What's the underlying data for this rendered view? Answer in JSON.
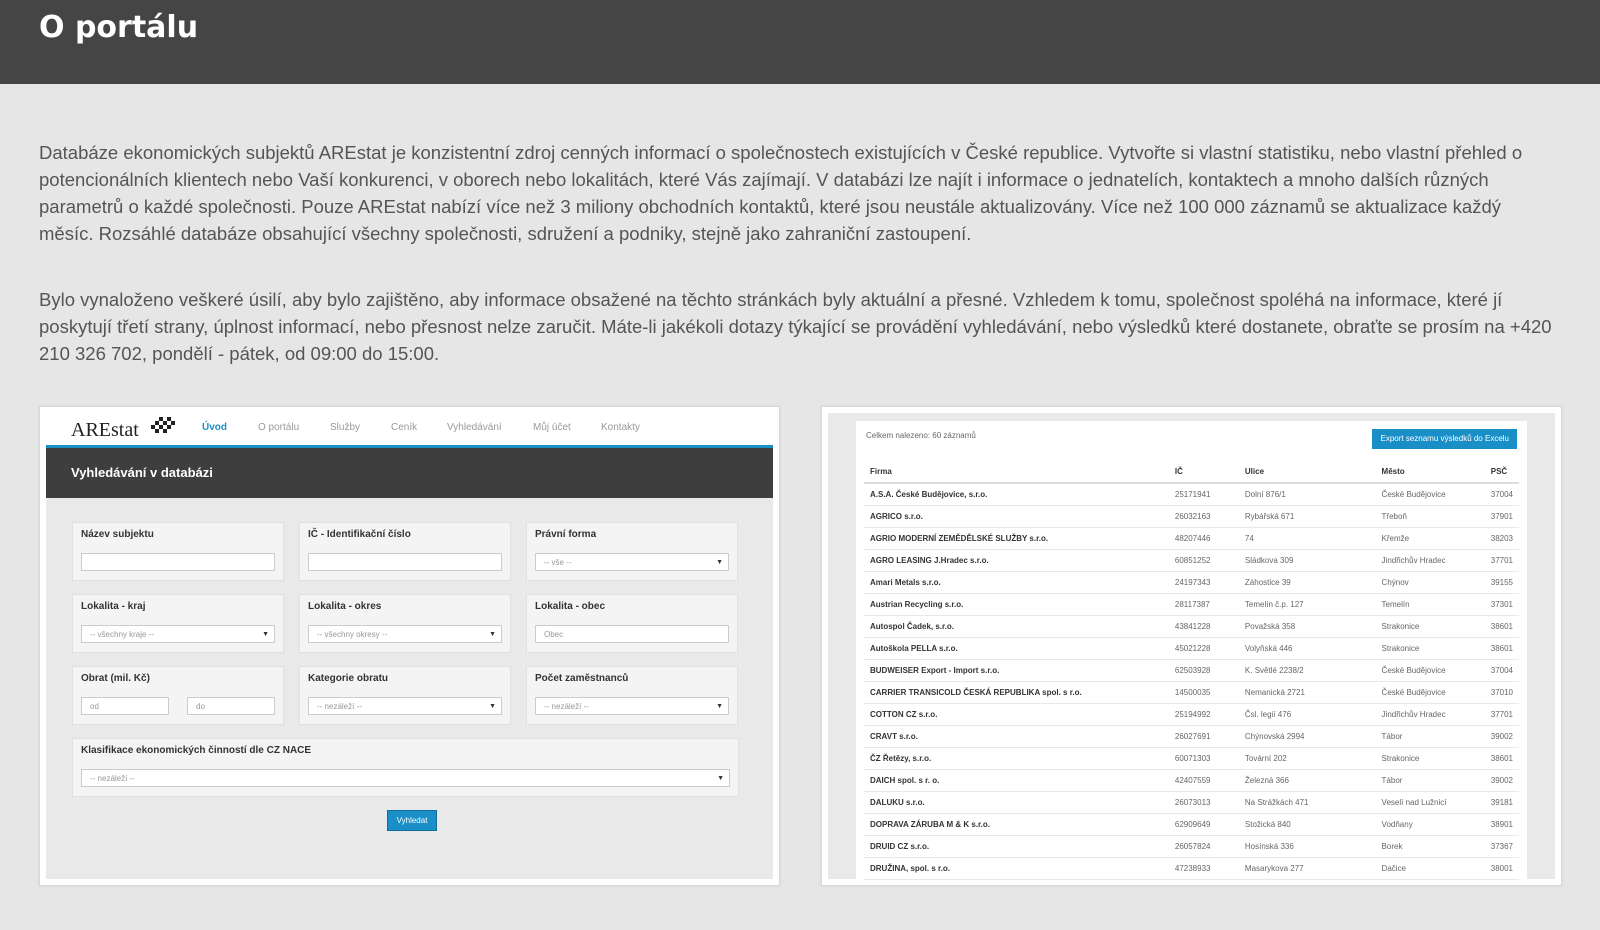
{
  "page": {
    "title": "O portálu",
    "paragraph1": "Databáze ekonomických subjektů AREstat je konzistentní zdroj cenných informací o společnostech existujících v České republice. Vytvořte si vlastní statistiku, nebo vlastní přehled o potencionálních klientech nebo Vaší konkurenci, v oborech nebo lokalitách, které Vás zajímají. V databázi lze najít i informace o jednatelích, kontaktech a mnoho dalších různých parametrů o každé společnosti. Pouze AREstat nabízí více než 3 miliony obchodních kontaktů, které jsou neustále aktualizovány. Více než 100 000 záznamů se aktualizace každý měsíc. Rozsáhlé databáze obsahující všechny společnosti, sdružení a podniky, stejně jako zahraniční zastoupení.",
    "paragraph2": "Bylo vynaloženo veškeré úsilí, aby bylo zajištěno, aby informace obsažené na těchto stránkách byly aktuální a přesné. Vzhledem k tomu, společnost spoléhá na informace, které jí poskytují třetí strany, úplnost informací, nebo přesnost nelze zaručit. Máte-li jakékoli dotazy týkající se provádění vyhledávání, nebo výsledků které dostanete, obraťte se prosím na +420 210 326 702, pondělí - pátek, od 09:00 do 15:00."
  },
  "search_mock": {
    "logo": "AREstat",
    "nav": [
      "Úvod",
      "O portálu",
      "Služby",
      "Ceník",
      "Vyhledávání",
      "Můj účet",
      "Kontakty"
    ],
    "band_title": "Vyhledávání v databázi",
    "fields": {
      "name_label": "Název subjektu",
      "ico_label": "IČ - Identifikační číslo",
      "legal_label": "Právní forma",
      "legal_value": "-- vše --",
      "region_label": "Lokalita - kraj",
      "region_value": "-- všechny kraje --",
      "district_label": "Lokalita - okres",
      "district_value": "-- všechny okresy --",
      "city_label": "Lokalita - obec",
      "city_placeholder": "Obec",
      "turnover_label": "Obrat (mil. Kč)",
      "turnover_from": "od",
      "turnover_to": "do",
      "turnover_cat_label": "Kategorie obratu",
      "turnover_cat_value": "-- nezáleží --",
      "employees_label": "Počet zaměstnanců",
      "employees_value": "-- nezáleží --",
      "nace_label": "Klasifikace ekonomických činností dle CZ NACE",
      "nace_value": "-- nezáleží --"
    },
    "search_button": "Vyhledat"
  },
  "results_mock": {
    "found_text": "Celkem nalezeno: 60 záznamů",
    "export_button": "Export seznamu výsledků do Excelu",
    "columns": [
      "Firma",
      "IČ",
      "Ulice",
      "Město",
      "PSČ"
    ],
    "rows": [
      [
        "A.S.A. České Budějovice, s.r.o.",
        "25171941",
        "Dolní 876/1",
        "České Budějovice",
        "37004"
      ],
      [
        "AGRICO s.r.o.",
        "26032163",
        "Rybářská 671",
        "Třeboň",
        "37901"
      ],
      [
        "AGRIO MODERNÍ ZEMĚDĚLSKÉ SLUŽBY s.r.o.",
        "48207446",
        "74",
        "Křemže",
        "38203"
      ],
      [
        "AGRO LEASING J.Hradec s.r.o.",
        "60851252",
        "Sládkova 309",
        "Jindřichův Hradec",
        "37701"
      ],
      [
        "Amari Metals s.r.o.",
        "24197343",
        "Záhostice 39",
        "Chýnov",
        "39155"
      ],
      [
        "Austrian Recycling s.r.o.",
        "28117387",
        "Temelín č.p. 127",
        "Temelín",
        "37301"
      ],
      [
        "Autospol Čadek, s.r.o.",
        "43841228",
        "Považská 358",
        "Strakonice",
        "38601"
      ],
      [
        "Autoškola PELLA s.r.o.",
        "45021228",
        "Volyňská 446",
        "Strakonice",
        "38601"
      ],
      [
        "BUDWEISER Export - Import s.r.o.",
        "62503928",
        "K. Světlé 2238/2",
        "České Budějovice",
        "37004"
      ],
      [
        "CARRIER TRANSICOLD ČESKÁ REPUBLIKA spol. s r.o.",
        "14500035",
        "Nemanická 2721",
        "České Budějovice",
        "37010"
      ],
      [
        "COTTON CZ s.r.o.",
        "25194992",
        "Čsl. legií 476",
        "Jindřichův Hradec",
        "37701"
      ],
      [
        "CRAVT s.r.o.",
        "26027691",
        "Chýnovská 2994",
        "Tábor",
        "39002"
      ],
      [
        "ČZ Řetězy, s.r.o.",
        "60071303",
        "Tovární 202",
        "Strakonice",
        "38601"
      ],
      [
        "DAICH spol. s r. o.",
        "42407559",
        "Železná 366",
        "Tábor",
        "39002"
      ],
      [
        "DALUKU s.r.o.",
        "26073013",
        "Na Strážkách 471",
        "Veselí nad Lužnicí",
        "39181"
      ],
      [
        "DOPRAVA ZÁRUBA M & K s.r.o.",
        "62909649",
        "Stožická 840",
        "Vodňany",
        "38901"
      ],
      [
        "DRUID CZ s.r.o.",
        "26057824",
        "Hosínská 336",
        "Borek",
        "37367"
      ],
      [
        "DRUŽINA, spol. s r.o.",
        "47238933",
        "Masarykova 277",
        "Dačice",
        "38001"
      ]
    ]
  }
}
